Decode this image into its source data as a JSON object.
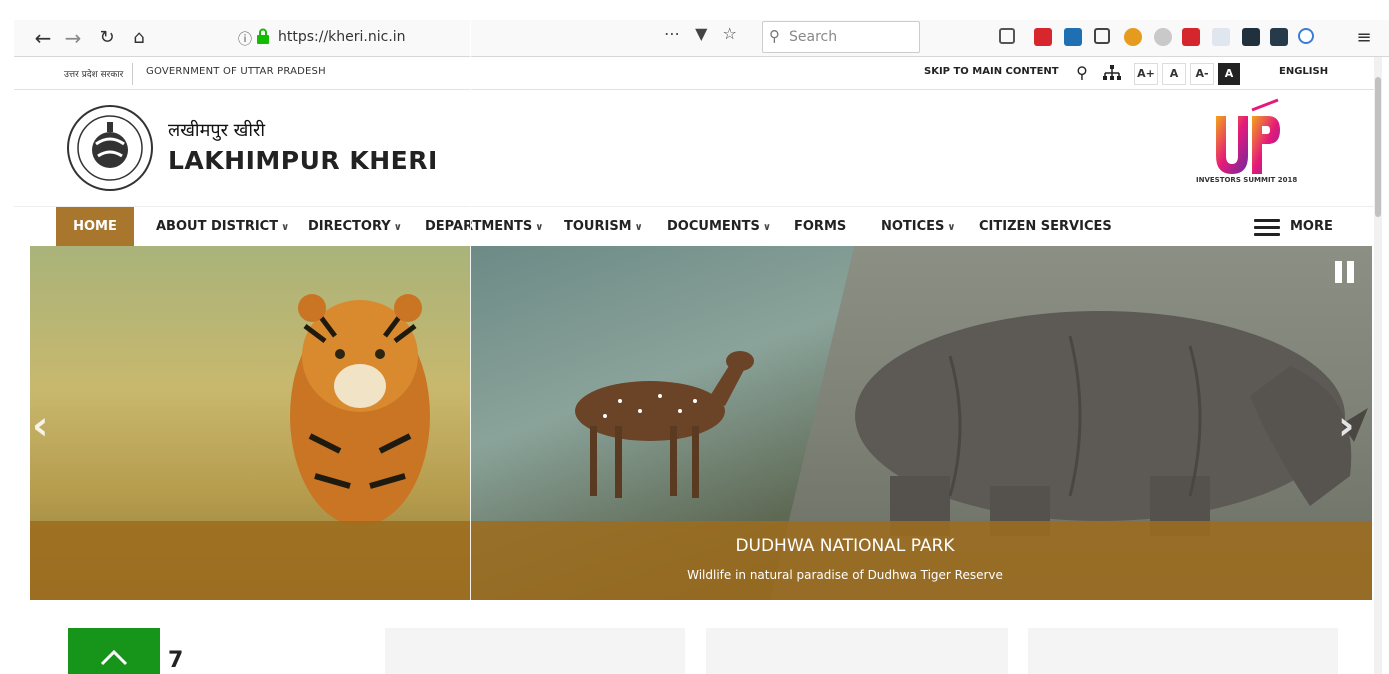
{
  "browser": {
    "back_icon": "back-arrow-icon",
    "forward_icon": "forward-arrow-icon",
    "reload_icon": "reload-icon",
    "home_icon": "home-icon",
    "url": "https://kheri.nic.in",
    "page_actions": "··· ☆",
    "search_placeholder": "Search"
  },
  "gov_bar": {
    "hindi_label": "उत्तर प्रदेश सरकार",
    "english_label": "GOVERNMENT OF UTTAR PRADESH",
    "skip_link": "SKIP TO MAIN CONTENT",
    "font_sizes": [
      "A+",
      "A",
      "A-",
      "A"
    ],
    "language": "ENGLISH"
  },
  "header": {
    "title_hindi": "लखीमपुर खीरी",
    "title_english": "LAKHIMPUR KHERI",
    "summit_caption": "INVESTORS SUMMIT 2018"
  },
  "nav": {
    "items": [
      {
        "label": "HOME",
        "dropdown": false
      },
      {
        "label": "ABOUT DISTRICT",
        "dropdown": true
      },
      {
        "label": "DIRECTORY",
        "dropdown": true
      },
      {
        "label": "DEPARTMENTS",
        "dropdown": true
      },
      {
        "label": "TOURISM",
        "dropdown": true
      },
      {
        "label": "DOCUMENTS",
        "dropdown": true
      },
      {
        "label": "FORMS",
        "dropdown": false
      },
      {
        "label": "NOTICES",
        "dropdown": true
      },
      {
        "label": "CITIZEN SERVICES",
        "dropdown": false
      }
    ],
    "more_label": "MORE"
  },
  "slider": {
    "title": "DUDHWA NATIONAL PARK",
    "subtitle": "Wildlife in natural paradise of Dudhwa Tiger Reserve"
  },
  "below": {
    "digit": "7"
  },
  "colors": {
    "nav_active": "#a9762e",
    "caption_band": "#9d6c1e",
    "green_box": "#17941a"
  }
}
